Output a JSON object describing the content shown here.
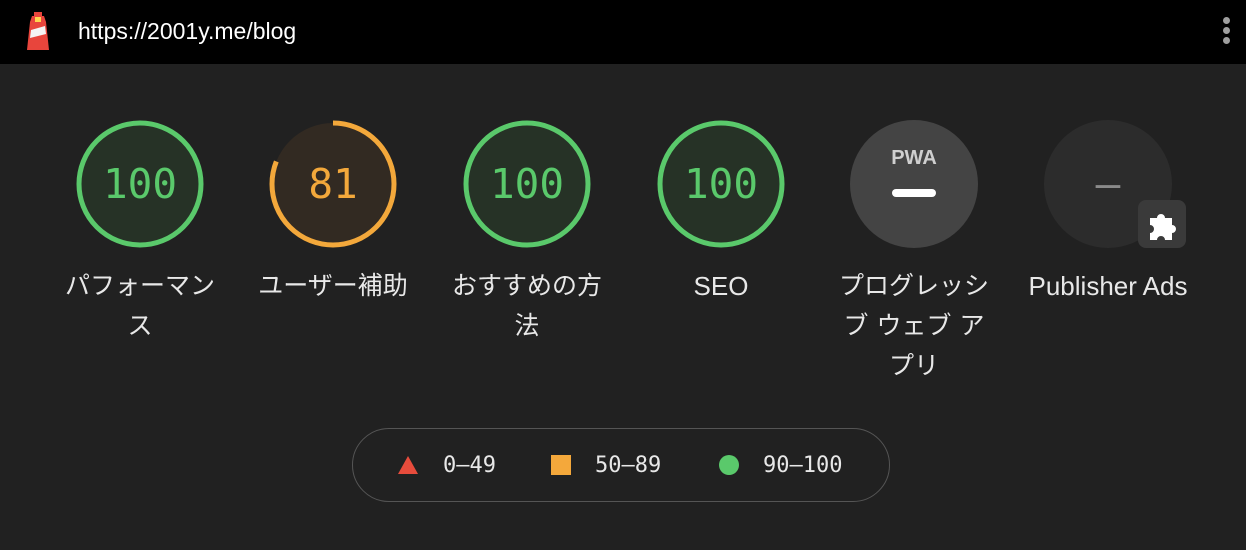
{
  "browser": {
    "url": "https://2001y.me/blog",
    "logo_icon": "lighthouse-icon",
    "menu_icon": "kebab-menu-icon"
  },
  "gauges": [
    {
      "label": "パフォーマンス",
      "score": "100",
      "fraction": 1.0,
      "color": "#0cce6b",
      "ring": "#5ac96b"
    },
    {
      "label": "ユーザー補助",
      "score": "81",
      "fraction": 0.81,
      "color": "#ffa400",
      "ring": "#f3a83b"
    },
    {
      "label": "おすすめの方法",
      "score": "100",
      "fraction": 1.0,
      "color": "#0cce6b",
      "ring": "#5ac96b"
    },
    {
      "label": "SEO",
      "score": "100",
      "fraction": 1.0,
      "color": "#0cce6b",
      "ring": "#5ac96b"
    },
    {
      "label": "プログレッシブ ウェブ アプリ",
      "badge": "PWA",
      "score": "—",
      "icon": "pwa-badge-icon"
    },
    {
      "label": "Publisher Ads",
      "score": "–",
      "icon": "puzzle-extension-icon"
    }
  ],
  "legend": [
    {
      "range": "0–49",
      "shape": "triangle",
      "color": "#e74c3c"
    },
    {
      "range": "50–89",
      "shape": "square",
      "color": "#f4a83b"
    },
    {
      "range": "90–100",
      "shape": "circle",
      "color": "#5ac96b"
    }
  ]
}
